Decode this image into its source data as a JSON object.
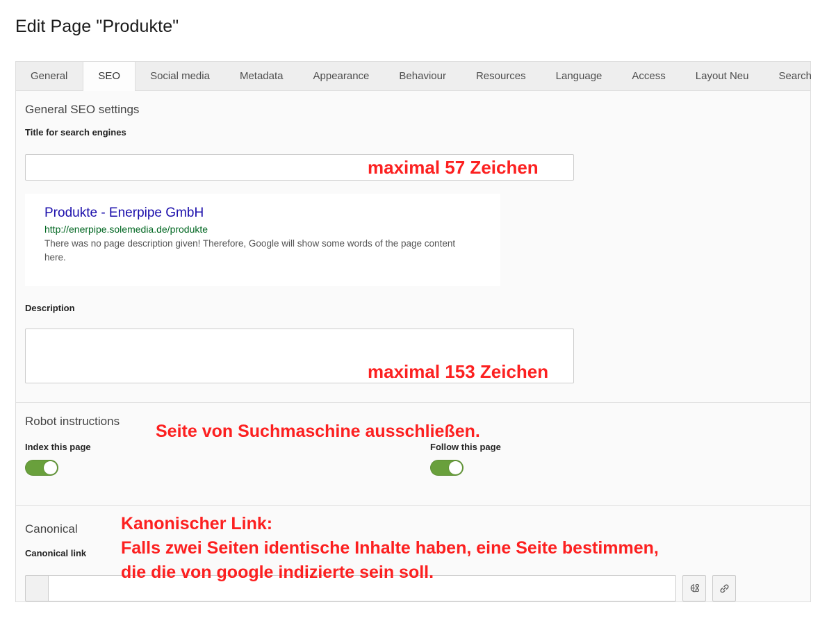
{
  "page_title": "Edit Page \"Produkte\"",
  "tabs": [
    {
      "label": "General",
      "active": false
    },
    {
      "label": "SEO",
      "active": true
    },
    {
      "label": "Social media",
      "active": false
    },
    {
      "label": "Metadata",
      "active": false
    },
    {
      "label": "Appearance",
      "active": false
    },
    {
      "label": "Behaviour",
      "active": false
    },
    {
      "label": "Resources",
      "active": false
    },
    {
      "label": "Language",
      "active": false
    },
    {
      "label": "Access",
      "active": false
    },
    {
      "label": "Layout Neu",
      "active": false
    },
    {
      "label": "Search",
      "active": false
    }
  ],
  "seo_section": {
    "legend": "General SEO settings",
    "title_label": "Title for search engines",
    "title_value": "",
    "description_label": "Description",
    "description_value": "",
    "preview": {
      "title": "Produkte - Enerpipe GmbH",
      "url": "http://enerpipe.solemedia.de/produkte",
      "description": "There was no page description given! Therefore, Google will show some words of the page content here."
    }
  },
  "robot_section": {
    "legend": "Robot instructions",
    "index_label": "Index this page",
    "index_on": true,
    "follow_label": "Follow this page",
    "follow_on": true
  },
  "canonical_section": {
    "legend": "Canonical",
    "link_label": "Canonical link",
    "link_value": "",
    "buttons": [
      {
        "name": "page-picker-icon",
        "title": "Select page"
      },
      {
        "name": "link-icon",
        "title": "Insert link"
      }
    ]
  },
  "annotations": {
    "title_max": "maximal 57 Zeichen",
    "description_max": "maximal 153 Zeichen",
    "robot_note": "Seite von Suchmaschine ausschließen.",
    "canonical_line1": "Kanonischer Link:",
    "canonical_line2": "Falls zwei Seiten identische Inhalte haben, eine Seite bestimmen,",
    "canonical_line3": "die die von google indizierte sein soll."
  },
  "colors": {
    "annotation_red": "#fc2020",
    "toggle_green": "#69a03c",
    "serp_title_blue": "#1a0dab",
    "serp_url_green": "#006621"
  }
}
